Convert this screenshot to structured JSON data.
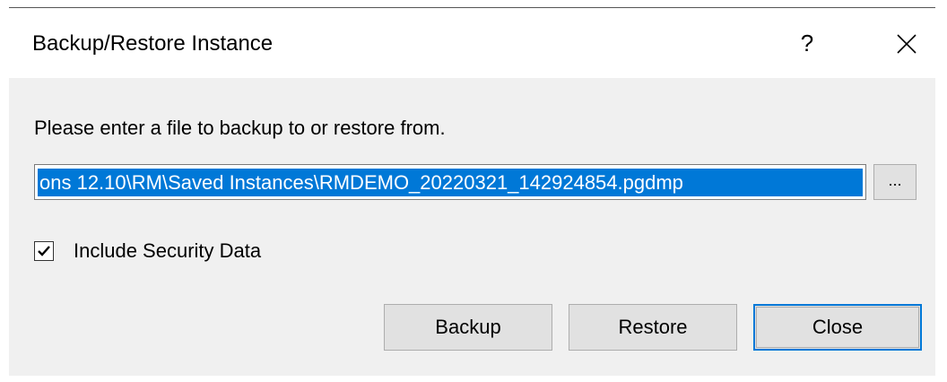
{
  "window": {
    "title": "Backup/Restore Instance",
    "help_label": "?",
    "close_icon": "close-icon"
  },
  "prompt": "Please enter a file to backup to or restore from.",
  "file_path": {
    "value": "ons 12.10\\RM\\Saved Instances\\RMDEMO_20220321_142924854.pgdmp",
    "selected": true
  },
  "browse_label": "...",
  "include_security": {
    "label": "Include Security Data",
    "checked": true
  },
  "buttons": {
    "backup": "Backup",
    "restore": "Restore",
    "close": "Close"
  },
  "colors": {
    "selection": "#0078d7",
    "dialog_bg": "#f0f0f0",
    "button_bg": "#e1e1e1"
  }
}
